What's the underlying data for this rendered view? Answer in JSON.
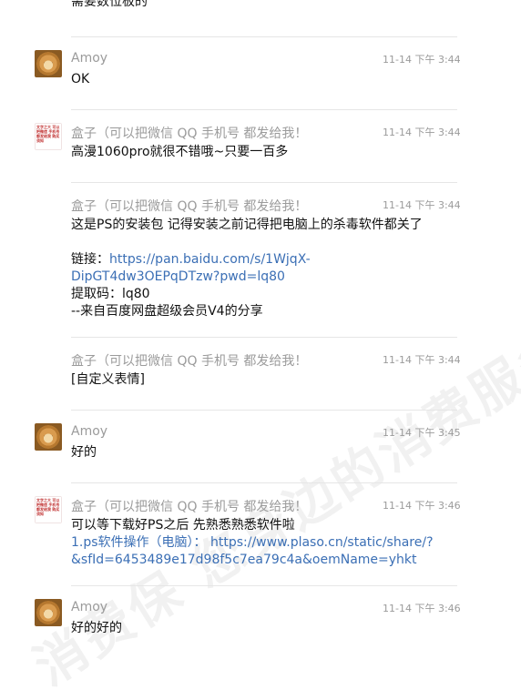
{
  "watermark": "消费保 您身边的消费服务",
  "top_partial_text": "需要数位板的",
  "messages": [
    {
      "sender": "Amoy",
      "time": "11-14 下午 3:44",
      "avatar": "dog-avatar",
      "lines": [
        "OK"
      ]
    },
    {
      "sender": "盒子（可以把微信 QQ 手机号 都发给我！",
      "time": "11-14 下午 3:44",
      "avatar": "box-avatar",
      "lines": [
        "高漫1060pro就很不错哦~只要一百多"
      ]
    },
    {
      "sender": "盒子（可以把微信 QQ 手机号 都发给我！",
      "time": "11-14 下午 3:44",
      "avatar": "",
      "lines": [
        "这是PS的安装包 记得安装之前记得把电脑上的杀毒软件都关了",
        "",
        "链接：",
        "https://pan.baidu.com/s/1WjqX-",
        "DipGT4dw3OEPqDTzw?pwd=lq80",
        "提取码：lq80",
        "--来自百度网盘超级会员V4的分享"
      ]
    },
    {
      "sender": "盒子（可以把微信 QQ 手机号 都发给我！",
      "time": "11-14 下午 3:44",
      "avatar": "",
      "lines": [
        "[自定义表情]"
      ]
    },
    {
      "sender": "Amoy",
      "time": "11-14 下午 3:45",
      "avatar": "dog-avatar",
      "lines": [
        "好的"
      ]
    },
    {
      "sender": "盒子（可以把微信 QQ 手机号 都发给我！",
      "time": "11-14 下午 3:46",
      "avatar": "box-avatar",
      "lines": [
        "可以等下载好PS之后 先熟悉熟悉软件啦",
        "1.ps软件操作（电脑）：",
        "https://www.plaso.cn/static/share/?",
        "&sfId=6453489e17d98f5c7ea79c4a&oemName=yhkt"
      ]
    },
    {
      "sender": "Amoy",
      "time": "11-14 下午 3:46",
      "avatar": "dog-avatar",
      "lines": [
        "好的好的"
      ]
    }
  ],
  "box_avatar_text": "文字之大 可以把微信 手机号 都发给我 购买须知"
}
